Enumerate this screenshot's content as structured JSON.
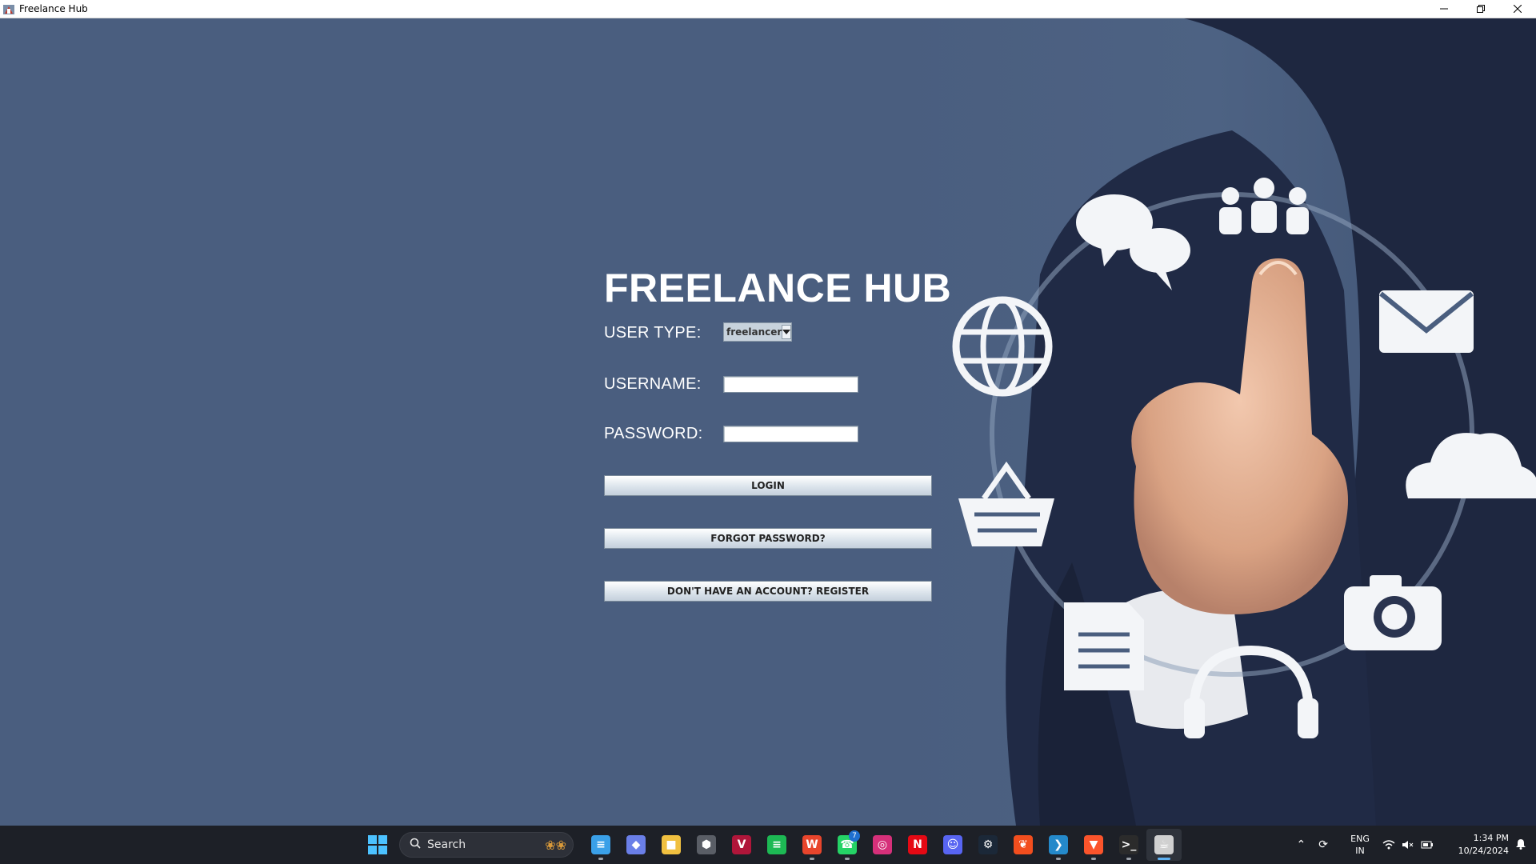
{
  "window": {
    "title": "Freelance Hub",
    "controls": {
      "minimize": "minimize-icon",
      "restore": "restore-icon",
      "close": "close-icon"
    }
  },
  "login": {
    "app_title": "FREELANCE HUB",
    "user_type_label": "USER TYPE:",
    "user_type_value": "freelancer",
    "username_label": "USERNAME:",
    "username_value": "",
    "password_label": "PASSWORD:",
    "password_value": "",
    "login_button": "LOGIN",
    "forgot_button": "FORGOT PASSWORD?",
    "register_button": "DON'T HAVE AN ACCOUNT? REGISTER"
  },
  "taskbar": {
    "search_placeholder": "Search",
    "apps": [
      {
        "name": "notepad",
        "icon": "notepad-icon",
        "color": "#3aa0e8",
        "running": true
      },
      {
        "name": "copilot",
        "icon": "copilot-icon",
        "color": "#6a7fe8",
        "running": false
      },
      {
        "name": "file-explorer",
        "icon": "folder-icon",
        "color": "#f0c040",
        "running": false
      },
      {
        "name": "unity",
        "icon": "unity-icon",
        "color": "#5a5e66",
        "running": false
      },
      {
        "name": "vectorizer",
        "icon": "v-icon",
        "color": "#b0163a",
        "running": false
      },
      {
        "name": "spotify",
        "icon": "spotify-icon",
        "color": "#1db954",
        "running": false
      },
      {
        "name": "wps-office",
        "icon": "w-icon",
        "color": "#e8452c",
        "running": true
      },
      {
        "name": "whatsapp",
        "icon": "whatsapp-icon",
        "color": "#25d366",
        "running": true,
        "badge": "7"
      },
      {
        "name": "instagram",
        "icon": "instagram-icon",
        "color": "#d6307a",
        "running": false
      },
      {
        "name": "netflix",
        "icon": "netflix-icon",
        "color": "#e50914",
        "running": false
      },
      {
        "name": "discord",
        "icon": "discord-icon",
        "color": "#5865f2",
        "running": false
      },
      {
        "name": "steam",
        "icon": "steam-icon",
        "color": "#1b2838",
        "running": false
      },
      {
        "name": "figma",
        "icon": "figma-icon",
        "color": "#f24e1e",
        "running": false
      },
      {
        "name": "vscode",
        "icon": "vscode-icon",
        "color": "#2489ca",
        "running": true
      },
      {
        "name": "brave",
        "icon": "brave-icon",
        "color": "#fb542b",
        "running": true
      },
      {
        "name": "terminal",
        "icon": "terminal-icon",
        "color": "#2b2b2b",
        "running": true
      },
      {
        "name": "java-app",
        "icon": "java-app-icon",
        "color": "#d0d0d0",
        "running": true,
        "active": true
      }
    ],
    "language": {
      "line1": "ENG",
      "line2": "IN"
    },
    "clock": {
      "time": "1:34 PM",
      "date": "10/24/2024"
    }
  }
}
